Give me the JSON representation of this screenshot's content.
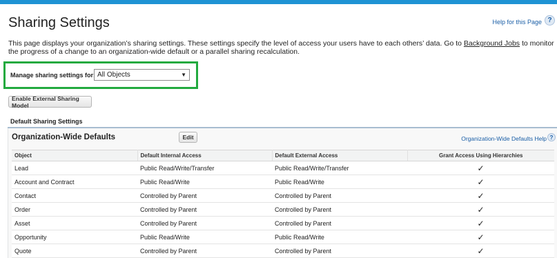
{
  "page": {
    "title": "Sharing Settings",
    "help_link": "Help for this Page",
    "help_icon": "?",
    "intro_before": "This page displays your organization’s sharing settings. These settings specify the level of access your users have to each others’ data. Go to ",
    "intro_link": "Background Jobs",
    "intro_after": " to monitor the progress of a change to an organization-wide default or a parallel sharing recalculation."
  },
  "manage": {
    "label": "Manage sharing settings for:",
    "selected": "All Objects",
    "highlight_color": "#22aa3f"
  },
  "buttons": {
    "enable_external": "Enable External Sharing Model",
    "edit": "Edit"
  },
  "default_sharing": {
    "heading": "Default Sharing Settings",
    "panel_title": "Organization-Wide Defaults",
    "help_link": "Organization-Wide Defaults Help",
    "help_icon": "?",
    "columns": [
      "Object",
      "Default Internal Access",
      "Default External Access",
      "Grant Access Using Hierarchies"
    ],
    "rows": [
      {
        "object": "Lead",
        "internal": "Public Read/Write/Transfer",
        "external": "Public Read/Write/Transfer",
        "grant": "✓"
      },
      {
        "object": "Account and Contract",
        "internal": "Public Read/Write",
        "external": "Public Read/Write",
        "grant": "✓"
      },
      {
        "object": "Contact",
        "internal": "Controlled by Parent",
        "external": "Controlled by Parent",
        "grant": "✓"
      },
      {
        "object": "Order",
        "internal": "Controlled by Parent",
        "external": "Controlled by Parent",
        "grant": "✓"
      },
      {
        "object": "Asset",
        "internal": "Controlled by Parent",
        "external": "Controlled by Parent",
        "grant": "✓"
      },
      {
        "object": "Opportunity",
        "internal": "Public Read/Write",
        "external": "Public Read/Write",
        "grant": "✓"
      },
      {
        "object": "Quote",
        "internal": "Controlled by Parent",
        "external": "Controlled by Parent",
        "grant": "✓"
      }
    ]
  },
  "colors": {
    "header_strip": "#1f93d4",
    "link": "#1a5ea6",
    "section_rule": "#a8bdd0"
  }
}
